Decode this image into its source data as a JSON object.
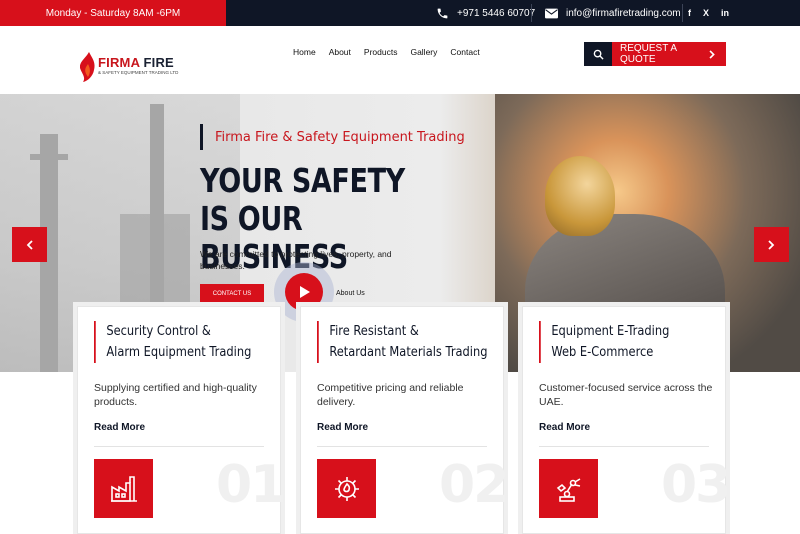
{
  "topbar": {
    "hours": "Monday - Saturday  8AM -6PM",
    "phone": "+971 5446 60707",
    "email": "info@firmafiretrading.com",
    "social": [
      "f",
      "X",
      "in"
    ]
  },
  "header": {
    "logo_name_red": "FIRMA",
    "logo_name_dark": "FIRE",
    "logo_tagline": "& SAFETY EQUIPMENT TRADING LTD",
    "nav": [
      "Home",
      "About",
      "Products",
      "Gallery",
      "Contact"
    ],
    "quote_label": "REQUEST A QUOTE"
  },
  "hero": {
    "kicker": "Firma Fire & Safety Equipment Trading",
    "title_line1": "YOUR SAFETY IS OUR",
    "title_line2": "BUSINESS",
    "description": "We are committed to protecting lives, property, and businesses.",
    "cta": "CONTACT US",
    "video_label": "About Us"
  },
  "cards": [
    {
      "title_1": "Security Control &",
      "title_2": "Alarm Equipment Trading",
      "text": "Supplying certified and high-quality products.",
      "more": "Read More",
      "number": "01",
      "icon": "factory-icon"
    },
    {
      "title_1": "Fire Resistant &",
      "title_2": "Retardant Materials Trading",
      "text": "Competitive pricing and reliable delivery.",
      "more": "Read More",
      "number": "02",
      "icon": "gear-flame-icon"
    },
    {
      "title_1": "Equipment E-Trading",
      "title_2": "Web E-Commerce",
      "text": "Customer-focused service across the UAE.",
      "more": "Read More",
      "number": "03",
      "icon": "robot-arm-icon"
    }
  ],
  "colors": {
    "brand_red": "#d7101b",
    "navy": "#0f1626"
  }
}
